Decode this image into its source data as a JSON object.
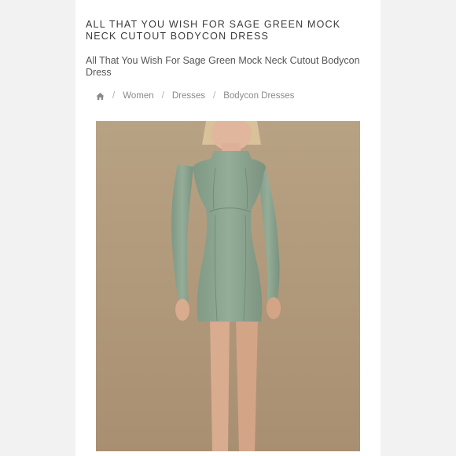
{
  "header": {
    "title": "ALL THAT YOU WISH FOR SAGE GREEN MOCK NECK CUTOUT BODYCON DRESS",
    "product_name": "All That You Wish For Sage Green Mock Neck Cutout Bodycon Dress"
  },
  "breadcrumb": {
    "home_icon": "home-icon",
    "items": [
      "Women",
      "Dresses",
      "Bodycon Dresses"
    ],
    "separator": "/"
  },
  "colors": {
    "background": "#f2f2f2",
    "card": "#ffffff",
    "photo_backdrop": "#b49d80",
    "dress": "#8fa894"
  }
}
